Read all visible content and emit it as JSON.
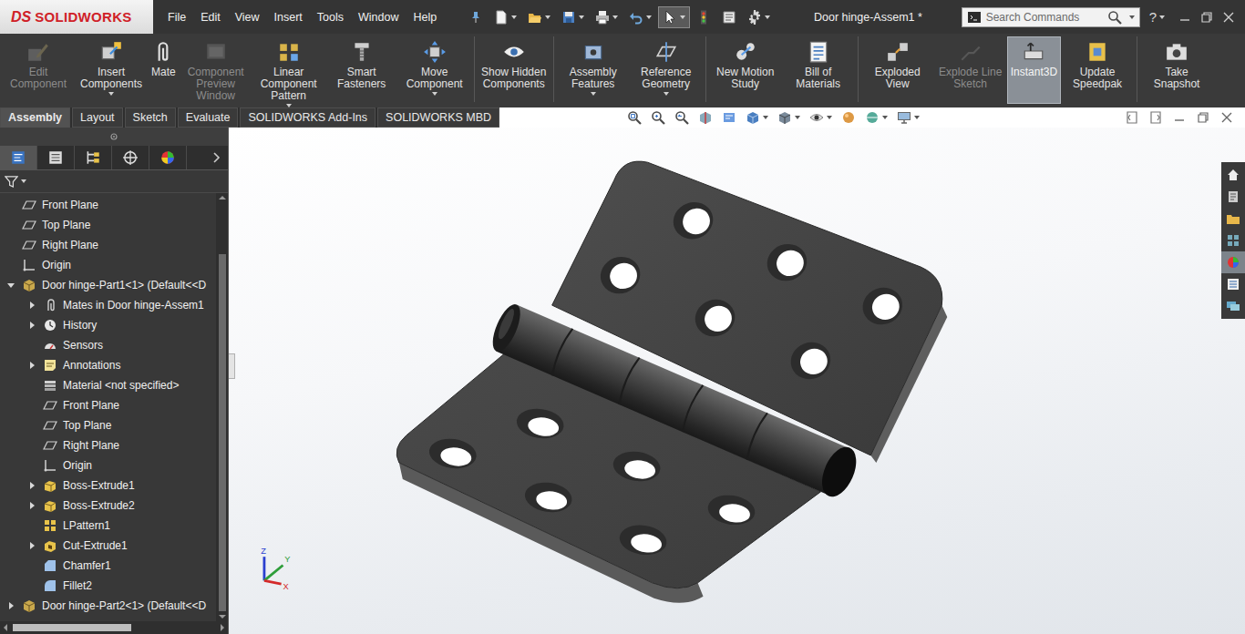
{
  "app": {
    "logo_mark": "DS",
    "logo_name": "SOLIDWORKS"
  },
  "menus": [
    "File",
    "Edit",
    "View",
    "Insert",
    "Tools",
    "Window",
    "Help"
  ],
  "quick_access": [
    {
      "kind": "pin",
      "dropdown": false,
      "selected": false
    },
    {
      "kind": "new",
      "dropdown": true,
      "selected": false
    },
    {
      "kind": "open",
      "dropdown": true,
      "selected": false
    },
    {
      "kind": "save",
      "dropdown": true,
      "selected": false
    },
    {
      "kind": "print",
      "dropdown": true,
      "selected": false
    },
    {
      "kind": "undo",
      "dropdown": true,
      "selected": false
    },
    {
      "kind": "select",
      "dropdown": true,
      "selected": true
    },
    {
      "kind": "rebuild",
      "dropdown": false,
      "selected": false
    },
    {
      "kind": "file-properties",
      "dropdown": false,
      "selected": false
    },
    {
      "kind": "options",
      "dropdown": true,
      "selected": false
    }
  ],
  "window": {
    "title": "Door hinge-Assem1 *"
  },
  "search": {
    "placeholder": "Search Commands"
  },
  "help": {
    "label": "?"
  },
  "ribbon": {
    "groups": [
      [
        {
          "label": "Edit Component",
          "kind": "edit-component",
          "disabled": true,
          "selected": false,
          "dropdown": false
        },
        {
          "label": "Insert Components",
          "kind": "insert-components",
          "disabled": false,
          "selected": false,
          "dropdown": true
        },
        {
          "label": "Mate",
          "kind": "mate",
          "disabled": false,
          "selected": false,
          "dropdown": false
        },
        {
          "label": "Component Preview Window",
          "kind": "preview-window",
          "disabled": true,
          "selected": false,
          "dropdown": false
        },
        {
          "label": "Linear Component Pattern",
          "kind": "linear-pattern",
          "disabled": false,
          "selected": false,
          "dropdown": true
        },
        {
          "label": "Smart Fasteners",
          "kind": "smart-fasteners",
          "disabled": false,
          "selected": false,
          "dropdown": false
        },
        {
          "label": "Move Component",
          "kind": "move-component",
          "disabled": false,
          "selected": false,
          "dropdown": true
        }
      ],
      [
        {
          "label": "Show Hidden Components",
          "kind": "show-hidden",
          "disabled": false,
          "selected": false,
          "dropdown": false
        }
      ],
      [
        {
          "label": "Assembly Features",
          "kind": "assembly-features",
          "disabled": false,
          "selected": false,
          "dropdown": true
        },
        {
          "label": "Reference Geometry",
          "kind": "reference-geometry",
          "disabled": false,
          "selected": false,
          "dropdown": true
        }
      ],
      [
        {
          "label": "New Motion Study",
          "kind": "motion-study",
          "disabled": false,
          "selected": false,
          "dropdown": false
        },
        {
          "label": "Bill of Materials",
          "kind": "bom",
          "disabled": false,
          "selected": false,
          "dropdown": false
        }
      ],
      [
        {
          "label": "Exploded View",
          "kind": "exploded-view",
          "disabled": false,
          "selected": false,
          "dropdown": false
        },
        {
          "label": "Explode Line Sketch",
          "kind": "explode-line",
          "disabled": true,
          "selected": false,
          "dropdown": false
        },
        {
          "label": "Instant3D",
          "kind": "instant3d",
          "disabled": false,
          "selected": true,
          "dropdown": false
        },
        {
          "label": "Update Speedpak",
          "kind": "speedpak",
          "disabled": false,
          "selected": false,
          "dropdown": false
        }
      ],
      [
        {
          "label": "Take Snapshot",
          "kind": "snapshot",
          "disabled": false,
          "selected": false,
          "dropdown": false
        }
      ]
    ]
  },
  "tabs": [
    {
      "label": "Assembly",
      "selected": true
    },
    {
      "label": "Layout",
      "selected": false
    },
    {
      "label": "Sketch",
      "selected": false
    },
    {
      "label": "Evaluate",
      "selected": false
    },
    {
      "label": "SOLIDWORKS Add-Ins",
      "selected": false
    },
    {
      "label": "SOLIDWORKS MBD",
      "selected": false
    }
  ],
  "feature_tree": {
    "panel_tabs": [
      {
        "kind": "feature-manager",
        "selected": true
      },
      {
        "kind": "property-manager",
        "selected": false
      },
      {
        "kind": "configuration-manager",
        "selected": false
      },
      {
        "kind": "dimxpert",
        "selected": false
      },
      {
        "kind": "display-manager",
        "selected": false
      }
    ],
    "items": [
      {
        "label": "Front Plane",
        "kind": "plane",
        "expandable": false,
        "expanded": false
      },
      {
        "label": "Top Plane",
        "kind": "plane",
        "expandable": false,
        "expanded": false
      },
      {
        "label": "Right Plane",
        "kind": "plane",
        "expandable": false,
        "expanded": false
      },
      {
        "label": "Origin",
        "kind": "origin",
        "expandable": false,
        "expanded": false
      },
      {
        "label": "Door hinge-Part1<1> (Default<<D",
        "kind": "part",
        "expandable": true,
        "expanded": true,
        "children": [
          {
            "label": "Mates in Door hinge-Assem1",
            "kind": "mates",
            "expandable": true,
            "expanded": false
          },
          {
            "label": "History",
            "kind": "history",
            "expandable": true,
            "expanded": false
          },
          {
            "label": "Sensors",
            "kind": "sensor",
            "expandable": false,
            "expanded": false
          },
          {
            "label": "Annotations",
            "kind": "annotation",
            "expandable": true,
            "expanded": false
          },
          {
            "label": "Material <not specified>",
            "kind": "material",
            "expandable": false,
            "expanded": false
          },
          {
            "label": "Front Plane",
            "kind": "plane",
            "expandable": false,
            "expanded": false
          },
          {
            "label": "Top Plane",
            "kind": "plane",
            "expandable": false,
            "expanded": false
          },
          {
            "label": "Right Plane",
            "kind": "plane",
            "expandable": false,
            "expanded": false
          },
          {
            "label": "Origin",
            "kind": "origin",
            "expandable": false,
            "expanded": false
          },
          {
            "label": "Boss-Extrude1",
            "kind": "extrude",
            "expandable": true,
            "expanded": false
          },
          {
            "label": "Boss-Extrude2",
            "kind": "extrude",
            "expandable": true,
            "expanded": false
          },
          {
            "label": "LPattern1",
            "kind": "pattern",
            "expandable": false,
            "expanded": false
          },
          {
            "label": "Cut-Extrude1",
            "kind": "cut",
            "expandable": true,
            "expanded": false
          },
          {
            "label": "Chamfer1",
            "kind": "chamfer",
            "expandable": false,
            "expanded": false
          },
          {
            "label": "Fillet2",
            "kind": "fillet",
            "expandable": false,
            "expanded": false
          }
        ]
      },
      {
        "label": "Door hinge-Part2<1> (Default<<D",
        "kind": "part",
        "expandable": true,
        "expanded": false
      }
    ]
  },
  "view_toolbar": [
    {
      "kind": "zoom-to-fit",
      "dropdown": false
    },
    {
      "kind": "zoom-area",
      "dropdown": false
    },
    {
      "kind": "previous-view",
      "dropdown": false
    },
    {
      "kind": "section-view",
      "dropdown": false
    },
    {
      "kind": "dynamic-annotation",
      "dropdown": false
    },
    {
      "kind": "view-orientation",
      "dropdown": true
    },
    {
      "kind": "display-style",
      "dropdown": true
    },
    {
      "kind": "hide-show",
      "dropdown": true
    },
    {
      "kind": "edit-appearance",
      "dropdown": false
    },
    {
      "kind": "apply-scene",
      "dropdown": true
    },
    {
      "kind": "view-settings",
      "dropdown": true
    }
  ],
  "task_pane": [
    {
      "kind": "home",
      "selected": false
    },
    {
      "kind": "resources",
      "selected": false
    },
    {
      "kind": "file-explorer",
      "selected": false
    },
    {
      "kind": "view-palette",
      "selected": false
    },
    {
      "kind": "appearances",
      "selected": true
    },
    {
      "kind": "custom-properties",
      "selected": false
    },
    {
      "kind": "forum",
      "selected": false
    }
  ],
  "triad": [
    {
      "label": "Z",
      "color": "#2a3fcf"
    },
    {
      "label": "Y",
      "color": "#2e9e3a"
    },
    {
      "label": "X",
      "color": "#d42a2a"
    }
  ]
}
